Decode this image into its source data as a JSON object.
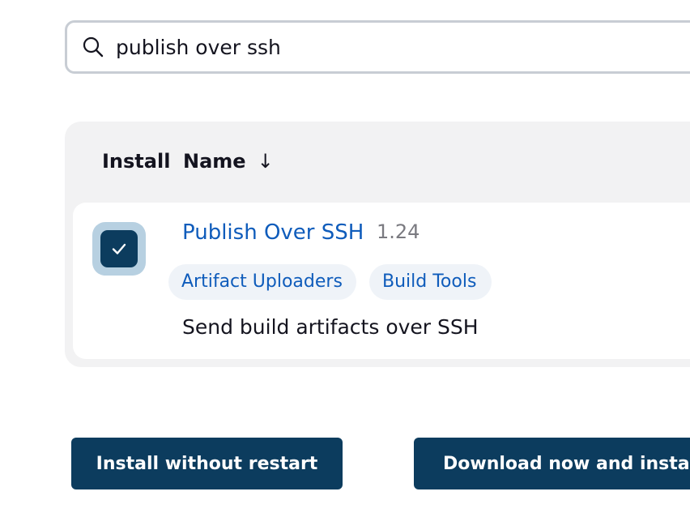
{
  "search": {
    "value": "publish over ssh",
    "icon": "search-icon"
  },
  "table": {
    "headers": {
      "install": "Install",
      "name": "Name",
      "sort_indicator": "↓"
    },
    "rows": [
      {
        "checked": true,
        "name": "Publish Over SSH",
        "version": "1.24",
        "tags": [
          "Artifact Uploaders",
          "Build Tools"
        ],
        "description": "Send build artifacts over SSH"
      }
    ]
  },
  "actions": {
    "install_without_restart": "Install without restart",
    "download_and_install": "Download now and install after restart"
  },
  "colors": {
    "primary": "#0c3c5e",
    "link": "#0f5cbb",
    "table_bg": "#f2f2f3",
    "tag_bg": "#eff3f8"
  }
}
